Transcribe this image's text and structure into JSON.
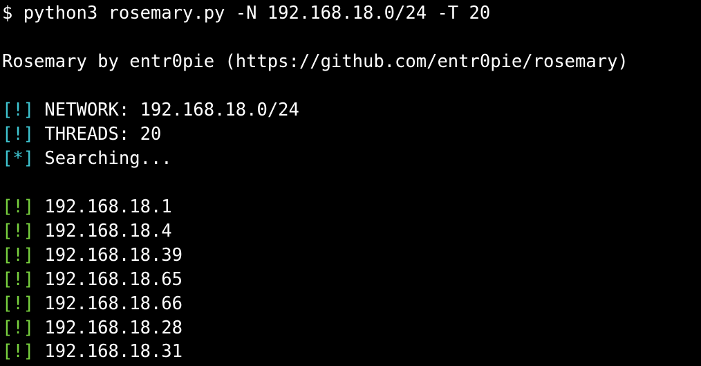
{
  "terminal": {
    "command": "$ python3 rosemary.py -N 192.168.18.0/24 -T 20",
    "banner": "Rosemary by entr0pie (https://github.com/entr0pie/rosemary)",
    "info": [
      {
        "tag": "[!]",
        "text": "NETWORK: 192.168.18.0/24"
      },
      {
        "tag": "[!]",
        "text": "THREADS: 20"
      },
      {
        "tag": "[*]",
        "text": "Searching..."
      }
    ],
    "results": [
      {
        "tag": "[!]",
        "text": "192.168.18.1"
      },
      {
        "tag": "[!]",
        "text": "192.168.18.4"
      },
      {
        "tag": "[!]",
        "text": "192.168.18.39"
      },
      {
        "tag": "[!]",
        "text": "192.168.18.65"
      },
      {
        "tag": "[!]",
        "text": "192.168.18.66"
      },
      {
        "tag": "[!]",
        "text": "192.168.18.28"
      },
      {
        "tag": "[!]",
        "text": "192.168.18.31"
      }
    ]
  },
  "colors": {
    "background": "#000000",
    "text": "#ffffff",
    "info_tag": "#3fc7d3",
    "found_tag": "#7ad33f"
  }
}
